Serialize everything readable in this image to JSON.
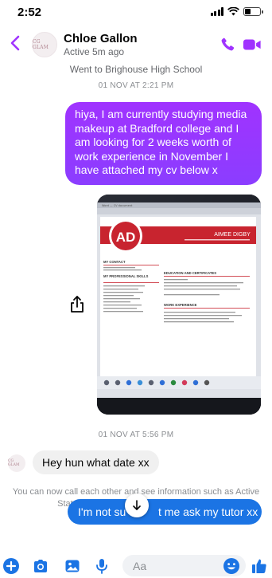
{
  "status_bar": {
    "time": "2:52"
  },
  "header": {
    "contact_name": "Chloe Gallon",
    "active_status": "Active 5m ago",
    "avatar_text": "CG GLAM"
  },
  "context": {
    "school": "Went to Brighouse High School"
  },
  "messages": {
    "timestamp_1": "01 NOV AT 2:21 PM",
    "outgoing_1": "hiya, I am currently studying media makeup at Bradford college and I am looking for 2 weeks worth of work experience in November I have attached my cv below x",
    "timestamp_2": "01 NOV AT 5:56 PM",
    "incoming_1": "Hey hun what date xx",
    "outgoing_2_visible": "I'm not su",
    "outgoing_2_visible_end": "t me ask my tutor xx"
  },
  "cv_photo": {
    "initials": "AD",
    "name": "AIMEE DIGBY",
    "section_contact": "MY CONTACT",
    "section_skills": "MY PROFESSIONAL SKILLS",
    "section_education": "EDUCATION AND CERTIFICATES",
    "section_work": "WORK EXPERIENCE"
  },
  "info_notice": "You can now call each other and see information such as Active Status and when you've read messages.",
  "composer": {
    "placeholder": "Aa"
  },
  "colors": {
    "messenger_purple": "#8b3dff",
    "messenger_blue": "#1b74e4",
    "accent_icons": "#a033ff",
    "cv_red": "#c8242f"
  },
  "icons": {
    "back": "chevron-left-icon",
    "call": "phone-icon",
    "video": "video-camera-icon",
    "share": "share-icon",
    "scroll": "arrow-down-icon",
    "plus": "plus-circle-icon",
    "camera": "camera-icon",
    "gallery": "image-icon",
    "mic": "microphone-icon",
    "emoji": "emoji-icon",
    "like": "thumbs-up-icon"
  }
}
